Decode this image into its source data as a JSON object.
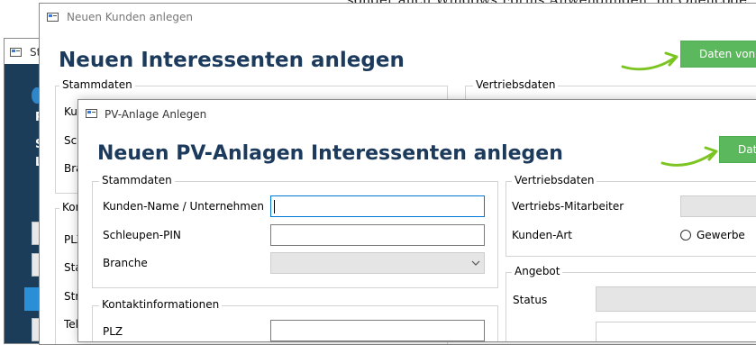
{
  "background_text": "sonder auch Windows Forms Anwendungen. Im Quellcode",
  "win_back": {
    "title_fragment": "St",
    "side_letters": [
      "P",
      "S",
      "L"
    ]
  },
  "win_mid": {
    "title": "Neuen Kunden anlegen",
    "heading": "Neuen Interessenten anlegen",
    "button": "Daten von",
    "group_stammdaten": "Stammdaten",
    "group_vertriebsdaten": "Vertriebsdaten",
    "group_kontakt_fragment": "Kon",
    "labels": [
      "Kun",
      "Sch",
      "Bra",
      "PLZ",
      "Sta",
      "Str",
      "Tel"
    ]
  },
  "win_front": {
    "title": "PV-Anlage Anlegen",
    "heading": "Neuen PV-Anlagen Interessenten anlegen",
    "button": "Dat",
    "stammdaten": {
      "title": "Stammdaten",
      "kunden_name_label": "Kunden-Name / Unternehmen",
      "kunden_name_value": "",
      "schleupen_pin_label": "Schleupen-PIN",
      "schleupen_pin_value": "",
      "branche_label": "Branche",
      "branche_value": ""
    },
    "kontakt": {
      "title": "Kontaktinformationen",
      "plz_label_fragment": "PLZ"
    },
    "vertriebsdaten": {
      "title": "Vertriebsdaten",
      "mitarbeiter_label": "Vertriebs-Mitarbeiter",
      "kunden_art_label": "Kunden-Art",
      "gewerbe_label": "Gewerbe"
    },
    "angebot": {
      "title": "Angebot",
      "status_label": "Status"
    }
  },
  "colors": {
    "heading": "#1b3a5c",
    "button_green": "#5cb85c",
    "arrow_green": "#7cc421",
    "sidebar_dark": "#1c3d5a",
    "focus_blue": "#0078d7"
  },
  "icons": [
    "app-icon",
    "arrow-icon",
    "chevron-down-icon",
    "radio-icon"
  ]
}
